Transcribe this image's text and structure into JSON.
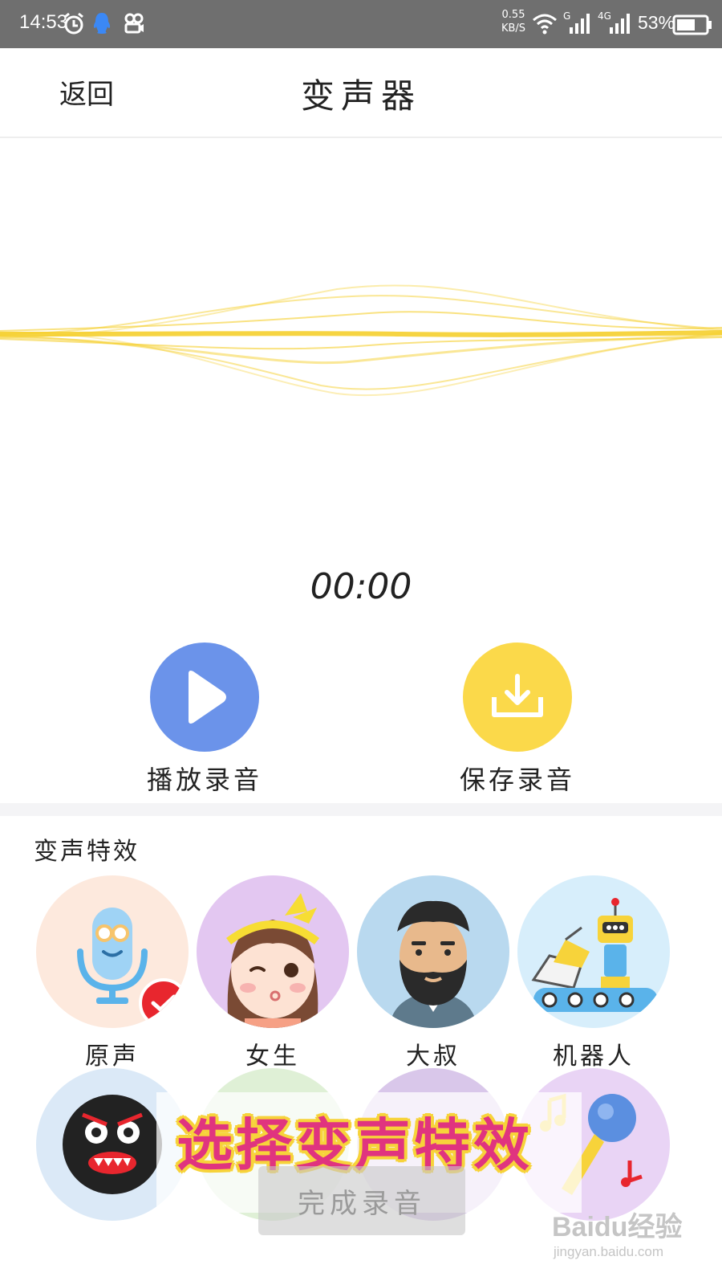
{
  "status_bar": {
    "time": "14:53",
    "net_speed": "0.55",
    "net_unit": "KB/S",
    "signal1_label": "G",
    "signal2_label": "4G",
    "battery": "53%"
  },
  "header": {
    "back_label": "返回",
    "title": "变声器"
  },
  "timer": "00:00",
  "actions": {
    "play_label": "播放录音",
    "save_label": "保存录音"
  },
  "effects_section": {
    "title": "变声特效",
    "items": [
      {
        "label": "原声",
        "selected": true
      },
      {
        "label": "女生",
        "selected": false
      },
      {
        "label": "大叔",
        "selected": false
      },
      {
        "label": "机器人",
        "selected": false
      }
    ]
  },
  "caption": "选择变声特效",
  "finish_button": "完成录音",
  "watermark": {
    "logo": "Baidu经验",
    "url": "jingyan.baidu.com"
  },
  "colors": {
    "play": "#6b93ea",
    "save": "#fbd94a",
    "check": "#e8262e",
    "wave": "#f5cf2d",
    "caption": "#e0347f"
  }
}
